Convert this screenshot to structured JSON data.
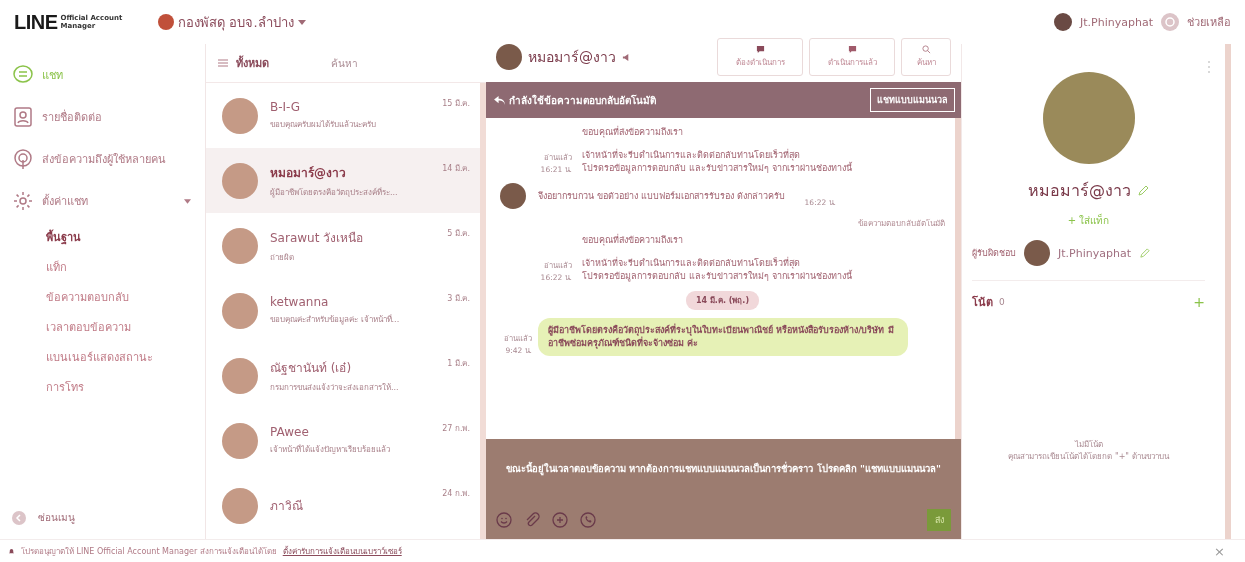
{
  "header": {
    "logo_main": "LINE",
    "logo_sub_1": "Official Account",
    "logo_sub_2": "Manager",
    "account": "กองพัสดุ อบจ.ลำปาง",
    "user": "Jt.Phinyaphat",
    "help": "ช่วยเหลือ"
  },
  "sidebar": {
    "items": [
      {
        "label": "แชท",
        "selected": true
      },
      {
        "label": "รายชื่อติดต่อ",
        "selected": false
      },
      {
        "label": "ส่งข้อความถึงผู้ใช้หลายคน",
        "selected": false
      },
      {
        "label": "ตั้งค่าแชท",
        "selected": false,
        "expanded": true,
        "children": [
          {
            "label": "พื้นฐาน",
            "selected": true
          },
          {
            "label": "แท็ก",
            "selected": false
          },
          {
            "label": "ข้อความตอบกลับ",
            "selected": false
          },
          {
            "label": "เวลาตอบข้อความ",
            "selected": false
          },
          {
            "label": "แบนเนอร์แสดงสถานะ",
            "selected": false
          },
          {
            "label": "การโทร",
            "selected": false
          }
        ]
      }
    ],
    "hide_menu": "ซ่อนเมนู"
  },
  "chat_list": {
    "filter": "ทั้งหมด",
    "search_placeholder": "ค้นหา",
    "rows": [
      {
        "name": "B-I-G",
        "preview": "ขอบคุณครับผมได้รับแล้วนะครับ",
        "time": "15 มี.ค.",
        "selected": false
      },
      {
        "name": "หมอมาร์@งาว",
        "preview": "ผู้มีอาชีพโดยตรงคือวัตถุประสงค์ที่ระ...",
        "time": "14 มี.ค.",
        "selected": true
      },
      {
        "name": "Sarawut วังเหนือ",
        "preview": "ถ่ายผิด",
        "time": "5 มี.ค.",
        "selected": false
      },
      {
        "name": "ketwanna",
        "preview": "ขอบคุณค่ะสำหรับข้อมูลค่ะ เจ้าหน้าที่...",
        "time": "3 มี.ค.",
        "selected": false
      },
      {
        "name": "ณัฐชานันท์ (เอ๋)",
        "preview": "กรมการขนส่งแจ้งว่าจะส่งเอกสารให้...",
        "time": "1 มี.ค.",
        "selected": false
      },
      {
        "name": "PAwee",
        "preview": "เจ้าหน้าที่ได้แจ้งปัญหาเรียบร้อยแล้ว",
        "time": "27 ก.พ.",
        "selected": false
      },
      {
        "name": "ภาวิณี",
        "preview": "",
        "time": "24 ก.พ.",
        "selected": false
      }
    ]
  },
  "chat": {
    "title": "หมอมาร์@งาว",
    "buttons": [
      "ต้องดำเนินการ",
      "ดำเนินการแล้ว",
      "ค้นหา"
    ],
    "banner": "กำลังใช้ข้อความตอบกลับอัตโนมัติ",
    "banner_button": "แชทแบบแมนนวล",
    "messages": [
      {
        "kind": "auto",
        "lines": [
          "ขอบคุณที่ส่งข้อความถึงเรา",
          "เจ้าหน้าที่จะรีบดำเนินการและติดต่อกลับท่านโดยเร็วที่สุด",
          "โปรดรอข้อมูลการตอบกลับ และรับข่าวสารใหม่ๆ จากเราผ่านช่องทางนี้"
        ],
        "read": "อ่านแล้ว",
        "time": "16:21 น."
      },
      {
        "kind": "incoming",
        "text": "จึงอยากรบกวน ขอตัวอย่าง แบบฟอร์มเอกสารรับรอง ดังกล่าวครับ",
        "time": "16:22 น."
      },
      {
        "kind": "auto",
        "label": "ข้อความตอบกลับอัตโนมัติ",
        "lines": [
          "ขอบคุณที่ส่งข้อความถึงเรา",
          "เจ้าหน้าที่จะรีบดำเนินการและติดต่อกลับท่านโดยเร็วที่สุด",
          "โปรดรอข้อมูลการตอบกลับ และรับข่าวสารใหม่ๆ จากเราผ่านช่องทางนี้"
        ],
        "read": "อ่านแล้ว",
        "time": "16:22 น."
      },
      {
        "kind": "date",
        "text": "14 มี.ค. (พฤ.)"
      },
      {
        "kind": "outgoing",
        "text": "ผู้มีอาชีพโดยตรงคือวัตถุประสงค์ที่ระบุในใบทะเบียนพาณิชย์ หรือหนังสือรับรองห้าง/บริษัท มีอาชีพซ่อมครุภัณฑ์ชนิดที่จะจ้างซ่อม ค่ะ",
        "read": "อ่านแล้ว",
        "time": "9:42 น."
      }
    ],
    "composer_notice": "ขณะนี้อยู่ในเวลาตอบข้อความ หากต้องการแชทแบบแมนนวลเป็นการชั่วคราว โปรดคลิก \"แชทแบบแมนนวล\"",
    "send": "ส่ง"
  },
  "profile": {
    "name": "หมอมาร์@งาว",
    "add_tag": "+ ใส่แท็ก",
    "assignee_label": "ผู้รับผิดชอบ",
    "assignee": "Jt.Phinyaphat",
    "notes_label": "โน้ต",
    "notes_count": "0",
    "add_note": "+",
    "empty_title": "ไม่มีโน้ต",
    "empty_hint": "คุณสามารถเขียนโน้ตได้โดยกด \"+\" ด้านขวาบน"
  },
  "notification_bar": {
    "text": "โปรดอนุญาตให้ LINE Official Account Manager ส่งการแจ้งเตือนได้โดย",
    "link": "ตั้งค่ารับการแจ้งเตือนบนเบราว์เซอร์",
    "close": "×"
  }
}
